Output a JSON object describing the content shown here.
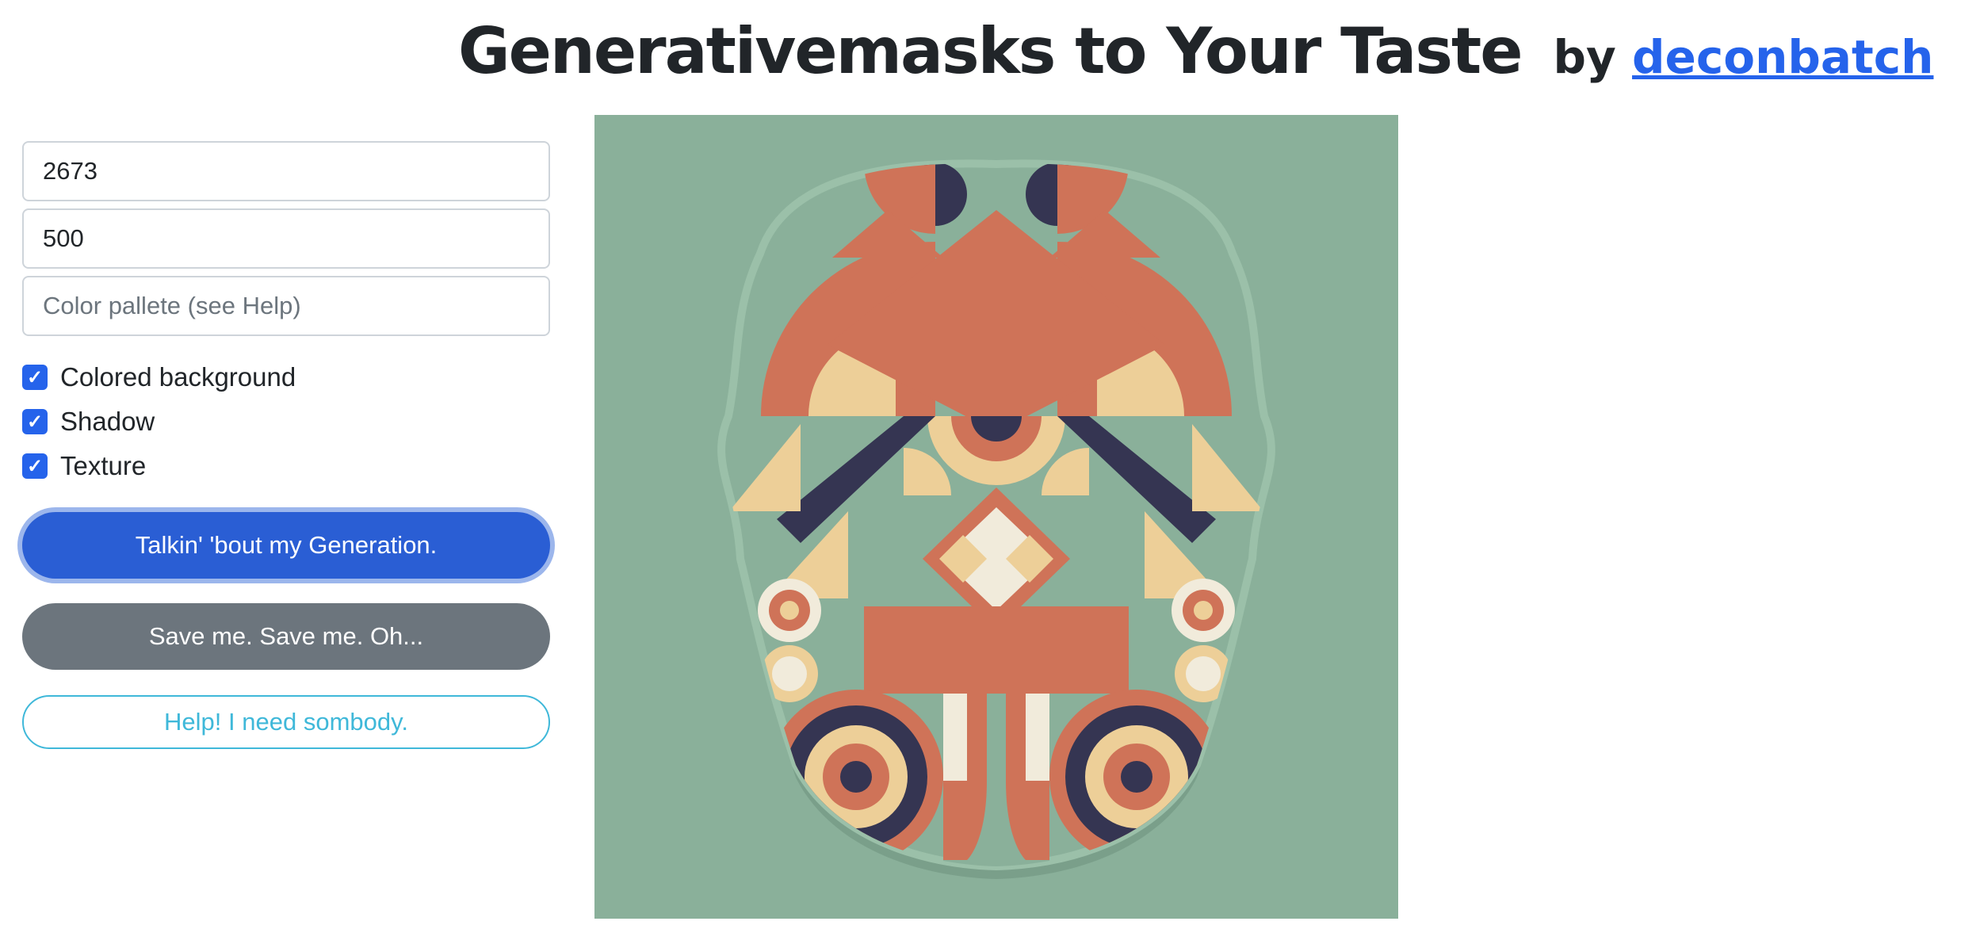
{
  "header": {
    "title": "Generativemasks to Your Taste",
    "by_label": "by",
    "author_link": "deconbatch"
  },
  "form": {
    "seed_value": "2673",
    "size_value": "500",
    "palette_placeholder": "Color pallete (see Help)"
  },
  "options": [
    {
      "label": "Colored background",
      "checked": true
    },
    {
      "label": "Shadow",
      "checked": true
    },
    {
      "label": "Texture",
      "checked": true
    }
  ],
  "buttons": {
    "generate": "Talkin' 'bout my Generation.",
    "save": "Save me. Save me. Oh...",
    "help": "Help! I need sombody."
  },
  "colors": {
    "canvas_bg": "#8ab09a",
    "coral": "#cf7358",
    "navy": "#353552",
    "sand": "#edcf98",
    "cream": "#f1ebdb",
    "accent": "#2563eb"
  }
}
